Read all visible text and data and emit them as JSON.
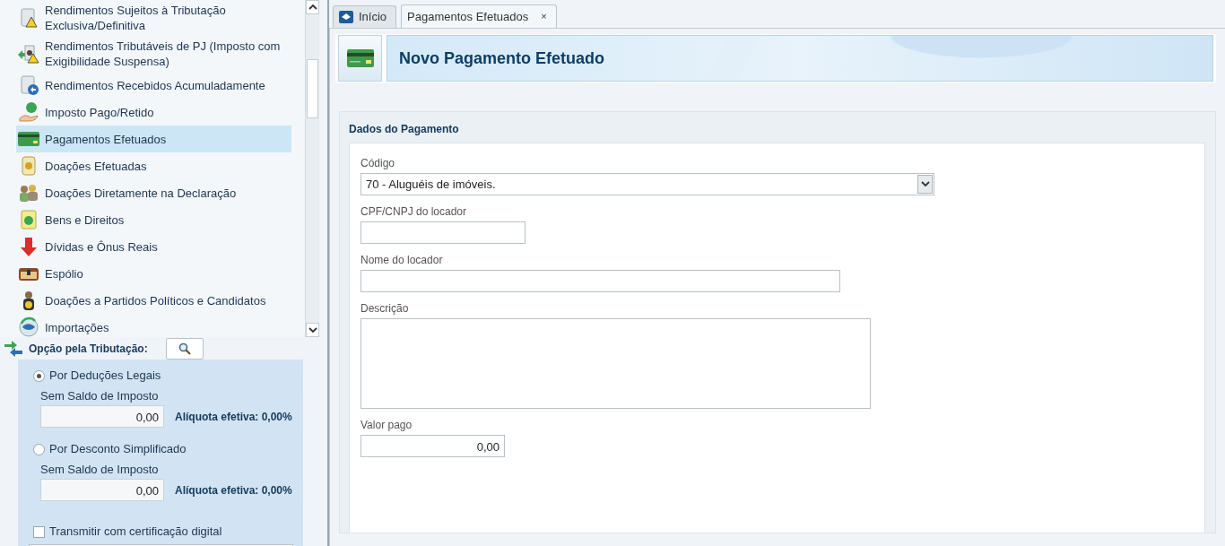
{
  "sidebar": {
    "items": [
      {
        "label": "Rendimentos Sujeitos à Tributação Exclusiva/Definitiva",
        "selected": false
      },
      {
        "label": "Rendimentos Tributáveis de PJ (Imposto com Exigibilidade Suspensa)",
        "selected": false
      },
      {
        "label": "Rendimentos Recebidos Acumuladamente",
        "selected": false
      },
      {
        "label": "Imposto Pago/Retido",
        "selected": false
      },
      {
        "label": "Pagamentos Efetuados",
        "selected": true
      },
      {
        "label": "Doações Efetuadas",
        "selected": false
      },
      {
        "label": "Doações Diretamente na Declaração",
        "selected": false
      },
      {
        "label": "Bens e Direitos",
        "selected": false
      },
      {
        "label": "Dívidas e Ônus Reais",
        "selected": false
      },
      {
        "label": "Espólio",
        "selected": false
      },
      {
        "label": "Doações a Partidos Políticos e Candidatos",
        "selected": false
      },
      {
        "label": "Importações",
        "selected": false
      }
    ]
  },
  "tax_option": {
    "title": "Opção pela Tributação:",
    "options": [
      {
        "label": "Por Deduções Legais",
        "selected": true,
        "sublabel": "Sem Saldo de Imposto",
        "value": "0,00",
        "rate": "Alíquota efetiva: 0,00%"
      },
      {
        "label": "Por Desconto Simplificado",
        "selected": false,
        "sublabel": "Sem Saldo de Imposto",
        "value": "0,00",
        "rate": "Alíquota efetiva: 0,00%"
      }
    ],
    "certificate": {
      "label": "Transmitir com certificação digital",
      "checked": false
    }
  },
  "tabs": [
    {
      "label": "Início",
      "selected": false
    },
    {
      "label": "Pagamentos Efetuados",
      "selected": true,
      "close_label": "×"
    }
  ],
  "page": {
    "title": "Novo Pagamento Efetuado"
  },
  "form": {
    "section_title": "Dados do Pagamento",
    "fields": [
      {
        "kind": "select",
        "label": "Código",
        "value": "70 - Aluguéis de imóveis."
      },
      {
        "kind": "text",
        "label": "CPF/CNPJ do locador"
      },
      {
        "kind": "text",
        "label": "Nome do locador"
      },
      {
        "kind": "textarea",
        "label": "Descrição"
      },
      {
        "kind": "number",
        "label": "Valor pago",
        "value": "0,00"
      }
    ]
  }
}
